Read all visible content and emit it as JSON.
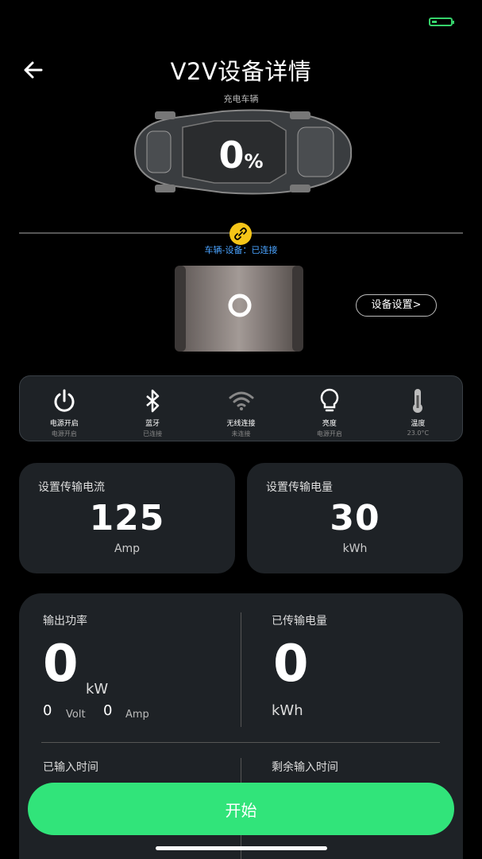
{
  "header": {
    "title": "V2V设备详情"
  },
  "vehicle": {
    "percent": "0",
    "percent_unit": "%",
    "cut_label": "充电车辆"
  },
  "connection": {
    "status": "车辆-设备：已连接"
  },
  "device": {
    "settings_label": "设备设置>"
  },
  "status_items": [
    {
      "icon": "power-icon",
      "label": "电源开启",
      "sub": "电源开启"
    },
    {
      "icon": "bluetooth-icon",
      "label": "蓝牙",
      "sub": "已连接"
    },
    {
      "icon": "wifi-icon",
      "label": "无线连接",
      "sub": "未连接"
    },
    {
      "icon": "lightbulb-icon",
      "label": "亮度",
      "sub": "电源开启"
    },
    {
      "icon": "thermometer-icon",
      "label": "温度",
      "sub": "23.0°C"
    }
  ],
  "cards": {
    "current": {
      "title": "设置传输电流",
      "value": "125",
      "unit": "Amp"
    },
    "energy": {
      "title": "设置传输电量",
      "value": "30",
      "unit": "kWh"
    }
  },
  "stats": {
    "output_power": {
      "label": "输出功率",
      "value": "0",
      "unit": "kW",
      "volt_value": "0",
      "volt_unit": "Volt",
      "amp_value": "0",
      "amp_unit": "Amp"
    },
    "transferred": {
      "label": "已传输电量",
      "value": "0",
      "unit": "kWh"
    },
    "input_time": {
      "label": "已输入时间"
    },
    "remaining_time": {
      "label": "剩余输入时间"
    }
  },
  "actions": {
    "start_label": "开始"
  },
  "colors": {
    "accent": "#31e47a",
    "link": "#4aa3ff",
    "badge": "#f5c518",
    "card": "#1e2226"
  }
}
